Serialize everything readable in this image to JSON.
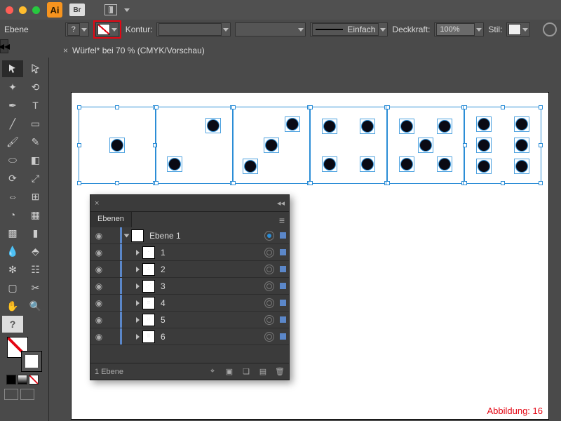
{
  "titlebar": {
    "bridge_label": "Br"
  },
  "control": {
    "context_label": "Ebene",
    "stroke_label": "Kontur:",
    "brush_style": "Einfach",
    "opacity_label": "Deckkraft:",
    "opacity_value": "100%",
    "style_label": "Stil:"
  },
  "document_tab": "Würfel* bei 70 % (CMYK/Vorschau)",
  "layers_panel": {
    "tab": "Ebenen",
    "rows": [
      {
        "name": "Ebene 1",
        "top": true
      },
      {
        "name": "1"
      },
      {
        "name": "2"
      },
      {
        "name": "3"
      },
      {
        "name": "4"
      },
      {
        "name": "5"
      },
      {
        "name": "6"
      }
    ],
    "footer": "1 Ebene"
  },
  "caption": "Abbildung: 16",
  "chart_data": {
    "type": "table",
    "description": "Six dice faces (1–6) drawn as squares with pips, all objects selected (blue bounding box handles). Fill: None (highlighted). Layers panel shows Ebene 1 containing sublayers 1-6.",
    "dice_faces": [
      1,
      2,
      3,
      4,
      5,
      6
    ]
  }
}
